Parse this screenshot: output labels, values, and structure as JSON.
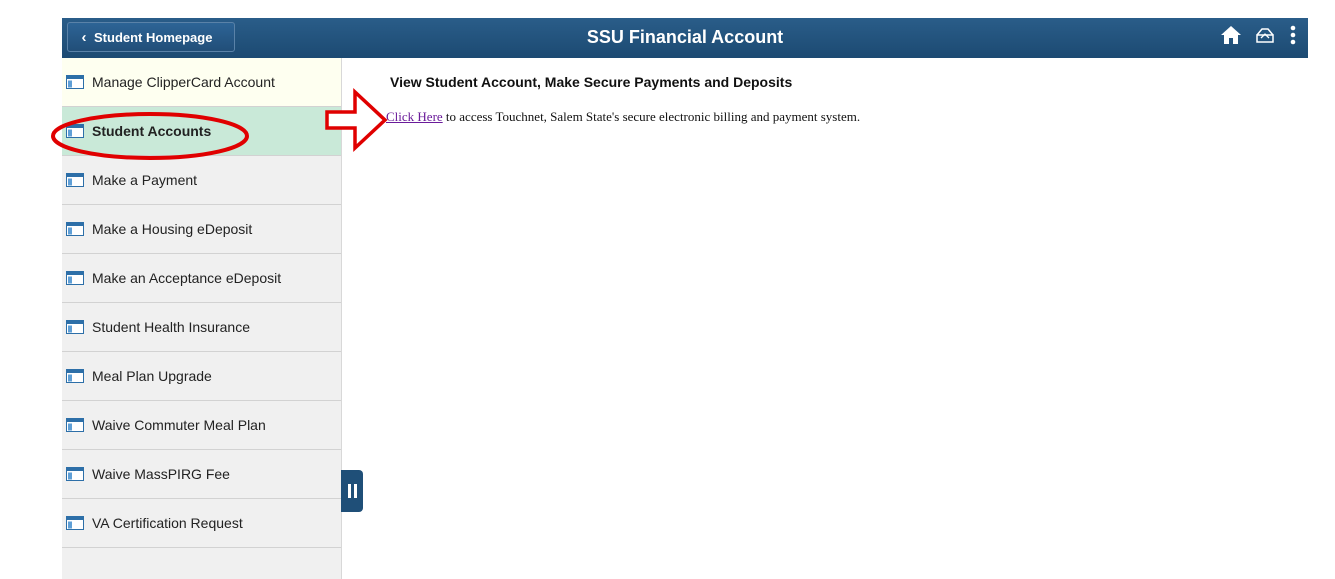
{
  "header": {
    "back_label": "Student Homepage",
    "title": "SSU Financial Account",
    "icons": [
      "home-icon",
      "navbar-icon",
      "actions-menu-icon"
    ],
    "bar_color": "#1f4f78"
  },
  "sidebar": {
    "items": [
      {
        "label": "Manage ClipperCard Account"
      },
      {
        "label": "Student Accounts",
        "selected": true
      },
      {
        "label": "Make a Payment"
      },
      {
        "label": "Make a Housing eDeposit"
      },
      {
        "label": "Make an Acceptance eDeposit"
      },
      {
        "label": "Student Health Insurance"
      },
      {
        "label": "Meal Plan Upgrade"
      },
      {
        "label": "Waive Commuter Meal Plan"
      },
      {
        "label": "Waive MassPIRG Fee"
      },
      {
        "label": "VA Certification Request"
      }
    ],
    "selected_color": "#c9e9d8"
  },
  "main": {
    "title": "View Student Account, Make Secure Payments and Deposits",
    "link_label": "Click Here",
    "description": " to access Touchnet, Salem State's secure electronic billing and payment system."
  },
  "annotations": {
    "color": "#e00000",
    "shapes": [
      "arrow",
      "ellipse"
    ]
  }
}
